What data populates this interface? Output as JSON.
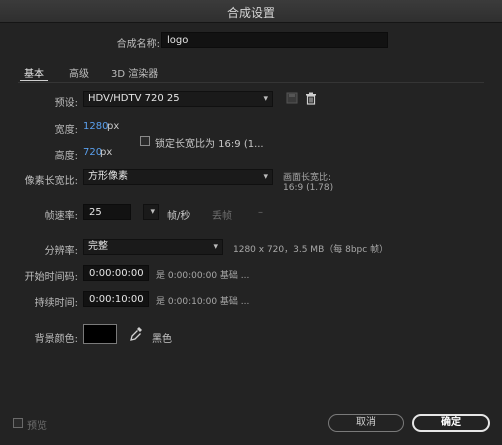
{
  "window": {
    "title": "合成设置"
  },
  "comp_name": {
    "label": "合成名称:",
    "value": "logo"
  },
  "tabs": [
    {
      "label": "基本"
    },
    {
      "label": "高级"
    },
    {
      "label": "3D 渲染器"
    }
  ],
  "preset": {
    "label": "预设:",
    "value": "HDV/HDTV 720 25"
  },
  "width": {
    "label": "宽度:",
    "value": "1280",
    "unit": "px"
  },
  "height": {
    "label": "高度:",
    "value": "720",
    "unit": "px"
  },
  "lock_aspect": {
    "label": "锁定长宽比为 16:9 (1...",
    "checked": false
  },
  "pixel_aspect": {
    "label": "像素长宽比:",
    "value": "方形像素"
  },
  "frame_aspect": {
    "label": "画面长宽比:",
    "value": "16:9 (1.78)"
  },
  "frame_rate": {
    "label": "帧速率:",
    "value": "25",
    "unit": "帧/秒",
    "drop_label": "丢帧",
    "dash": "–"
  },
  "resolution": {
    "label": "分辨率:",
    "value": "完整",
    "info": "1280 x 720，3.5 MB（每 8bpc 帧）"
  },
  "start_timecode": {
    "label": "开始时间码:",
    "value": "0:00:00:00",
    "info": "是 0:00:00:00 基础 ..."
  },
  "duration": {
    "label": "持续时间:",
    "value": "0:00:10:00",
    "info": "是 0:00:10:00 基础 ..."
  },
  "bg_color": {
    "label": "背景颜色:",
    "color": "#000000",
    "name": "黑色"
  },
  "footer": {
    "preview_label": "预览",
    "cancel_label": "取消",
    "ok_label": "确定"
  },
  "icons": {
    "chevron": "▾",
    "trash": "trash-icon",
    "save": "save-preset-icon",
    "eyedropper": "eyedropper-icon"
  }
}
